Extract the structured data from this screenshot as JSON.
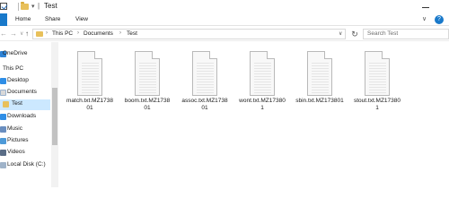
{
  "window": {
    "title": "Test",
    "separator": "|",
    "quick_access_dropdown": "▾"
  },
  "ribbon": {
    "tabs": [
      "Home",
      "Share",
      "View"
    ],
    "expand": "∨",
    "help": "?"
  },
  "address_bar": {
    "breadcrumb": [
      "This PC",
      "Documents",
      "Test"
    ],
    "chevron": "›",
    "dropdown": "∨",
    "refresh_icon": "↻"
  },
  "nav_buttons": {
    "back": "←",
    "forward": "→",
    "recent": "∨",
    "up": "↑"
  },
  "search": {
    "placeholder": "Search Test"
  },
  "sidebar": {
    "items": [
      {
        "label": "OneDrive",
        "icon": "onedrive-icon"
      },
      {
        "label": "This PC",
        "icon": "this-pc-icon"
      },
      {
        "label": "Desktop",
        "icon": "desktop-icon"
      },
      {
        "label": "Documents",
        "icon": "documents-icon"
      },
      {
        "label": "Test",
        "icon": "folder-icon",
        "selected": true
      },
      {
        "label": "Downloads",
        "icon": "downloads-icon"
      },
      {
        "label": "Music",
        "icon": "music-icon"
      },
      {
        "label": "Pictures",
        "icon": "pictures-icon"
      },
      {
        "label": "Videos",
        "icon": "videos-icon"
      },
      {
        "label": "Local Disk (C:)",
        "icon": "disk-icon"
      }
    ]
  },
  "files": [
    {
      "name": "match.txt.MZ173801"
    },
    {
      "name": "boom.txt.MZ173801"
    },
    {
      "name": "assoc.txt.MZ173801"
    },
    {
      "name": "wont.txt.MZ173801"
    },
    {
      "name": "sbin.txt.MZ173801"
    },
    {
      "name": "stout.txt.MZ173801"
    }
  ],
  "colors": {
    "accent": "#1979ca",
    "selection": "#cce8ff",
    "folder": "#e8c05a"
  }
}
